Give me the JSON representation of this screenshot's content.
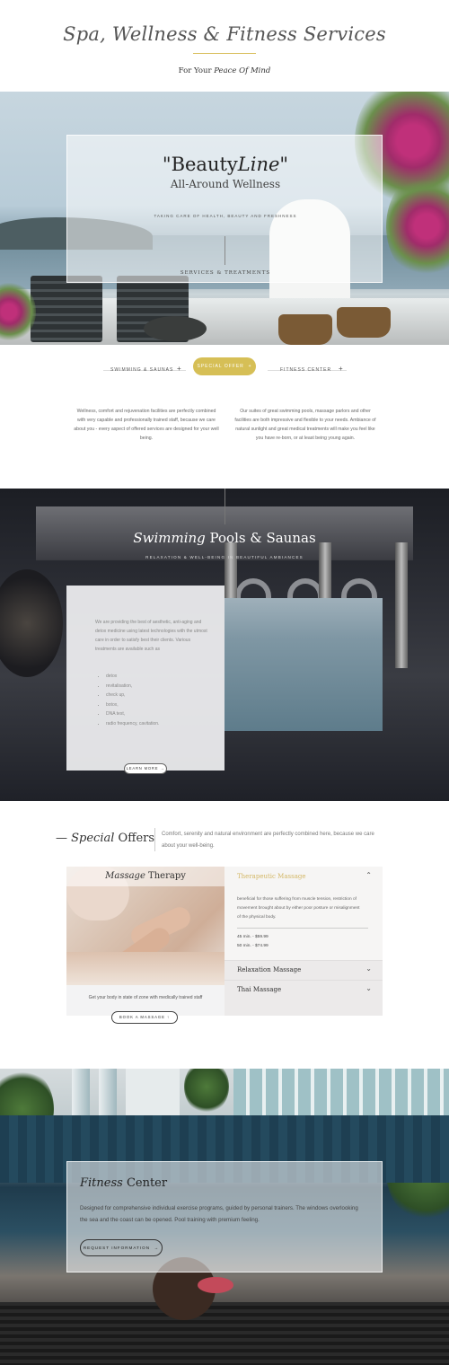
{
  "header": {
    "title": "Spa, Wellness & Fitness Services",
    "subtitle_prefix": "For Your",
    "subtitle_emphasis": "Peace Of Mind"
  },
  "hero": {
    "brand_quote_open": "\"Beauty",
    "brand_italic": "Line",
    "brand_quote_close": "\"",
    "subtitle": "All-Around Wellness",
    "tagline": "TAKING CARE OF HEALTH, BEAUTY AND FRESHNESS",
    "link": "SERVICES & TREATMENTS"
  },
  "tabs": [
    {
      "label": "SWIMMING & SAUNAS",
      "icon": "+"
    },
    {
      "label": "SPECIAL OFFER",
      "icon": "+"
    },
    {
      "label": "FITNESS CENTER",
      "icon": "+"
    }
  ],
  "intro": {
    "left": "Wellness, comfort and rejuvenation facilities  are perfectly combined with very capable and professionally trained staff, because we care about you - every aspect of offered services are designed for your well being.",
    "right": "Our suites of great swimming pools, massage parlors and other facilities  are both impressive and flexible to your needs. Ambiance of natural sunlight and great medical treatments will make you feel like you have re-born, or at least being young again."
  },
  "pools": {
    "title_italic": "Swimming",
    "title_rest": " Pools & Saunas",
    "tagline": "RELAXATION & WELL-BEING IN BEAUTIFUL AMBIANCES",
    "text": "We are providing the best of aesthetic, anti-aging and detox medicine using latest technologies with the utmost care in order to satisfy best their clients. Various treatments are available such as",
    "list": [
      "detox",
      "revitalisation,",
      "check up,",
      "botox,",
      "DNA test,",
      "radio frequency, cavitation."
    ],
    "button": "LEARN MORE",
    "button_icon": "→"
  },
  "offers": {
    "title_dash": "—",
    "title_italic": "Special",
    "title_rest": " Offers",
    "description": "Comfort, serenity and natural environment are perfectly combined here, because we care about your well-being.",
    "massage_italic": "Massage",
    "massage_rest": " Therapy",
    "massage_note": "Get your body in state of zone with medically trained staff",
    "book_button": "BOOK A MASSAGE",
    "book_icon": "↑",
    "accordion": [
      {
        "title": "Therapeutic Massage",
        "open": true,
        "body": "beneficial for those suffering from muscle tension, restriction of movement brought about by either poor posture or misalignment of the physical body.",
        "prices": [
          "45 min. - $59.99",
          "50 min. - $74.99"
        ]
      },
      {
        "title": "Relaxation Massage",
        "open": false
      },
      {
        "title": "Thai Massage",
        "open": false
      }
    ],
    "accent_color": "#d3b765"
  },
  "fitness": {
    "title_italic": "Fitness",
    "title_rest": " Center",
    "description": "Designed for comprehensive individual exercise programs, guided by personal trainers. The windows overlooking the sea and the coast can be opened. Pool training with premium feeling.",
    "button": "REQUEST INFORMATION",
    "button_icon": "→"
  },
  "colors": {
    "gold": "#d6bf56",
    "dark": "#222222"
  }
}
